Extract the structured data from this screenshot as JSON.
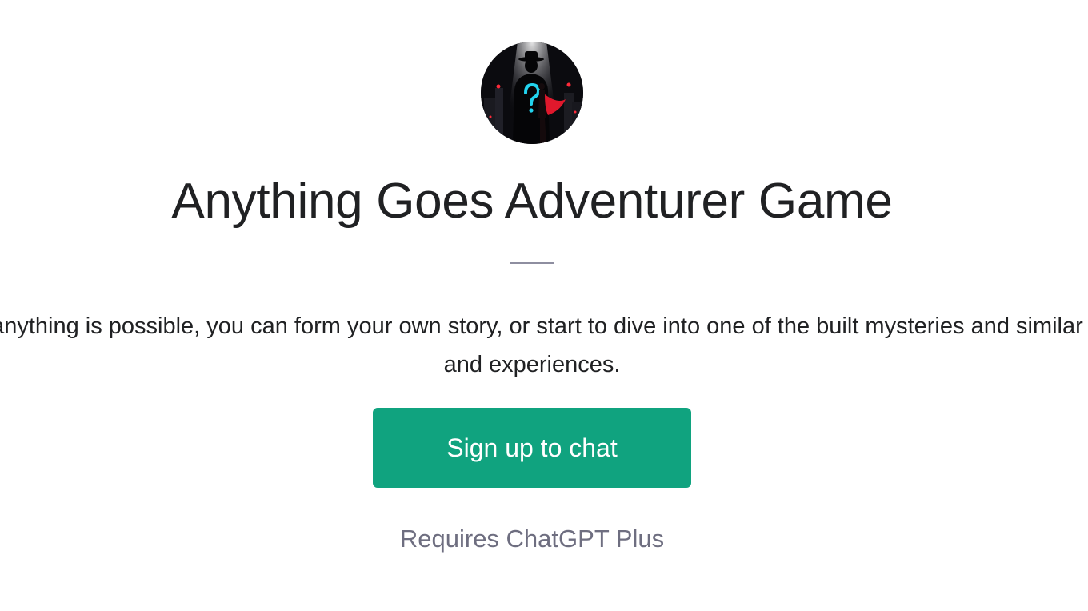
{
  "gpt": {
    "avatar_icon": "detective-mystery-avatar-icon",
    "title": "Anything Goes Adventurer Game",
    "description": "Literally anything is possible, you can form your own story, or start to dive into one of the built mysteries and similar games and experiences.",
    "cta_label": "Sign up to chat",
    "requirement": "Requires ChatGPT Plus"
  },
  "colors": {
    "accent": "#10a37f",
    "title_text": "#202123",
    "muted_text": "#6e6e80",
    "divider": "#8e8ea0"
  }
}
